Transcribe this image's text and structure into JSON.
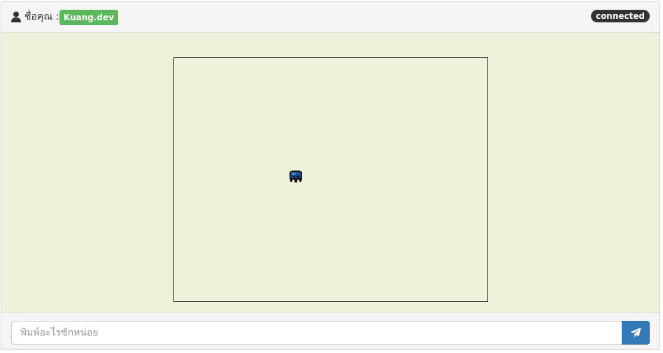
{
  "header": {
    "user_icon": "user-icon",
    "name_label": "ชื่อคุณ :",
    "user_name": "Kuang.dev",
    "user_name_color": "#5cb85c",
    "connection_status": "connected",
    "connection_status_color": "#333333"
  },
  "game": {
    "background_color": "#f0f1da",
    "player_sprite": "blue-ghost-sprite"
  },
  "chat": {
    "input_placeholder": "พิมพ์อะไรซักหน่อย",
    "input_value": "",
    "send_icon": "paper-plane-icon",
    "send_button_color": "#337ab7"
  }
}
